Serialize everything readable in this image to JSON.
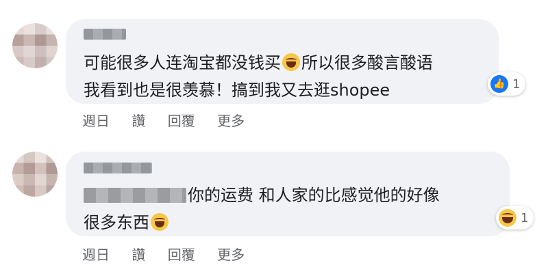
{
  "comments": [
    {
      "lines": [
        "可能很多人连淘宝都没钱买",
        "所以很多酸言酸语",
        "我看到也是很羡慕！搞到我又去逛shopee"
      ],
      "emoji_icon": "laughing-tears-emoji",
      "reaction": {
        "icon": "like-icon",
        "count": "1",
        "color": "#1877f2"
      },
      "actions": [
        "週日",
        "讚",
        "回覆",
        "更多"
      ]
    },
    {
      "lines": [
        "你的运费 和人家的比感觉他的好像",
        "很多东西"
      ],
      "emoji_icon": "laughing-tears-emoji",
      "reaction": {
        "icon": "laugh-icon",
        "count": "1",
        "color": "#f7c748"
      },
      "actions": [
        "週日",
        "讚",
        "回覆",
        "更多"
      ]
    }
  ],
  "colors": {
    "bubble": "#f0f2f5",
    "text": "#1c1e21",
    "meta": "#65676b"
  }
}
